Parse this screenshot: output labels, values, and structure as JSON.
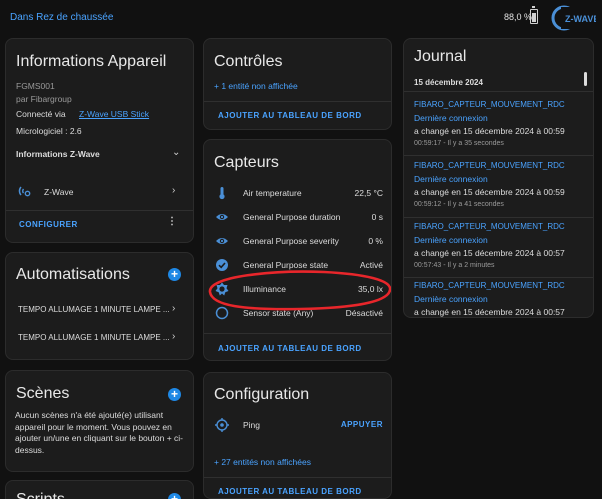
{
  "header": {
    "breadcrumb": "Dans Rez de chaussée",
    "battery": "88,0 %",
    "zwave_logo": "Z-WAVE"
  },
  "device_info": {
    "title": "Informations Appareil",
    "model": "FGMS001",
    "manufacturer": "par Fibargroup",
    "connected_prefix": "Connecté via",
    "connected_link": "Z-Wave USB Stick",
    "firmware": "Micrologiciel : 2.6",
    "zwave_section": "Informations Z-Wave",
    "zwave_item": "Z-Wave",
    "configure": "CONFIGURER"
  },
  "automations": {
    "title": "Automatisations",
    "items": [
      "TEMPO ALLUMAGE 1 MINUTE LAMPE ...",
      "TEMPO ALLUMAGE 1 MINUTE LAMPE ..."
    ]
  },
  "scenes": {
    "title": "Scènes",
    "empty_text": "Aucun scènes n'a été ajouté(e) utilisant appareil pour le moment. Vous pouvez en ajouter un/une en cliquant sur le bouton + ci-dessus."
  },
  "scripts": {
    "title": "Scripts"
  },
  "controls": {
    "title": "Contrôles",
    "hidden": "+ 1 entité non affichée",
    "add_dashboard": "AJOUTER AU TABLEAU DE BORD"
  },
  "sensors": {
    "title": "Capteurs",
    "rows": [
      {
        "icon": "thermometer-icon",
        "label": "Air temperature",
        "value": "22,5 °C"
      },
      {
        "icon": "eye-icon",
        "label": "General Purpose duration",
        "value": "0 s"
      },
      {
        "icon": "eye-icon",
        "label": "General Purpose severity",
        "value": "0 %"
      },
      {
        "icon": "check-circle-icon",
        "label": "General Purpose state",
        "value": "Activé"
      },
      {
        "icon": "brightness-icon",
        "label": "Illuminance",
        "value": "35,0 lx"
      },
      {
        "icon": "circle-outline-icon",
        "label": "Sensor state (Any)",
        "value": "Désactivé"
      }
    ],
    "add_dashboard": "AJOUTER AU TABLEAU DE BORD",
    "highlight_color": "#e8262b"
  },
  "configuration": {
    "title": "Configuration",
    "ping_label": "Ping",
    "ping_action": "APPUYER",
    "hidden": "+ 27 entités non affichées",
    "add_dashboard": "AJOUTER AU TABLEAU DE BORD"
  },
  "journal": {
    "title": "Journal",
    "date": "15 décembre 2024",
    "entries": [
      {
        "entity": "FIBARO_CAPTEUR_MOUVEMENT_RDC",
        "event": "Dernière connexion",
        "change": "a changé en 15 décembre 2024 à 00:59",
        "time": "00:59:17 - Il y a 35 secondes"
      },
      {
        "entity": "FIBARO_CAPTEUR_MOUVEMENT_RDC",
        "event": "Dernière connexion",
        "change": "a changé en 15 décembre 2024 à 00:59",
        "time": "00:59:12 - Il y a 41 secondes"
      },
      {
        "entity": "FIBARO_CAPTEUR_MOUVEMENT_RDC",
        "event": "Dernière connexion",
        "change": "a changé en 15 décembre 2024 à 00:57",
        "time": "00:57:43 - Il y a 2 minutes"
      },
      {
        "entity": "FIBARO_CAPTEUR_MOUVEMENT_RDC",
        "event": "Dernière connexion",
        "change": "a changé en 15 décembre 2024 à 00:57",
        "time": ""
      }
    ]
  },
  "colors": {
    "background": "#111111",
    "card": "#1c1c1c",
    "accent": "#4aa3ff",
    "icon_blue": "#4a8fd6"
  }
}
